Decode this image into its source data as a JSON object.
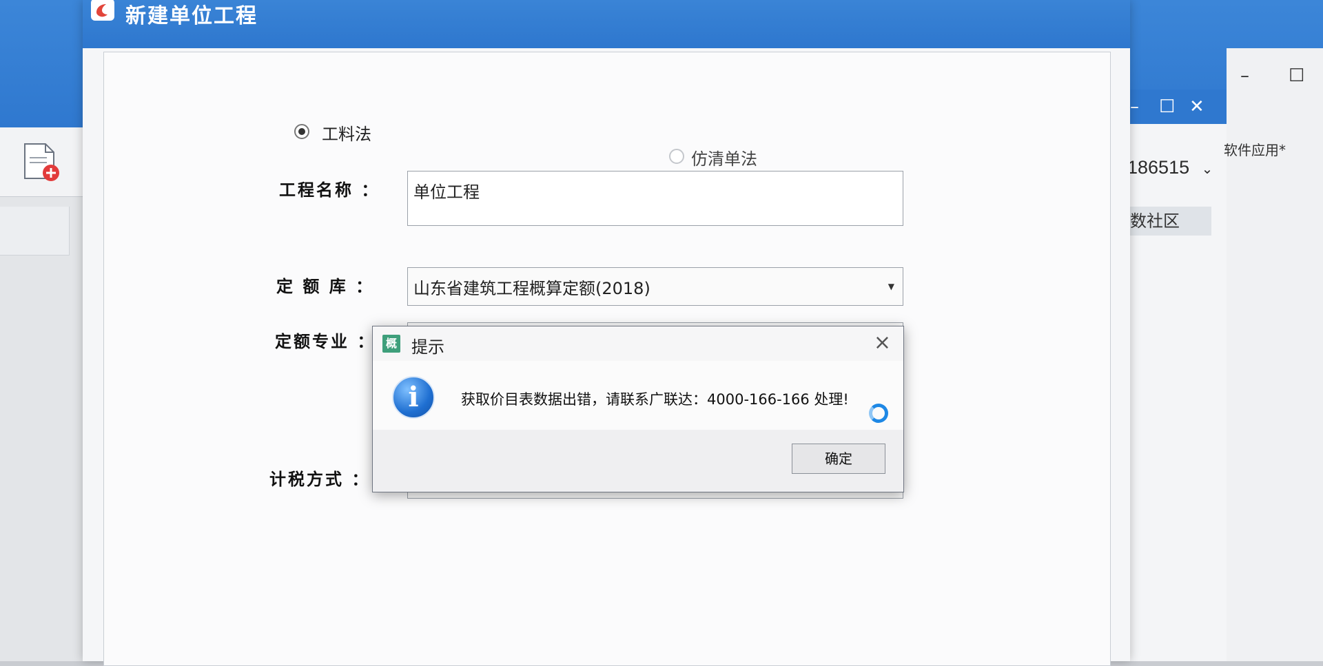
{
  "background_app": {
    "account_text": "186515",
    "community_tab": "数社区",
    "side_menu_text": "软件应用*"
  },
  "dialog": {
    "title": "新建单位工程",
    "method_options": [
      {
        "label": "工料法",
        "selected": true
      },
      {
        "label": "仿清单法",
        "selected": false
      }
    ],
    "fields": {
      "project_name": {
        "label": "工程名称 ：",
        "value": "单位工程"
      },
      "quota_library": {
        "label": "定 额 库 ：",
        "value": "山东省建筑工程概算定额(2018)"
      },
      "quota_specialty": {
        "label": "定额专业 ：",
        "value": ""
      },
      "tax_method": {
        "label": "计税方式 ：",
        "value": ""
      }
    }
  },
  "prompt": {
    "app_icon_text": "概",
    "title": "提示",
    "message": "获取价目表数据出错，请联系广联达：4000-166-166 处理!",
    "ok_label": "确定"
  },
  "colors": {
    "title_bar_blue": "#2e77ce",
    "info_icon_blue": "#1f6fd1"
  },
  "icons": {
    "new_file": "new-file-icon",
    "close": "close-icon",
    "info": "info-icon",
    "dropdown": "chevron-down-icon"
  }
}
